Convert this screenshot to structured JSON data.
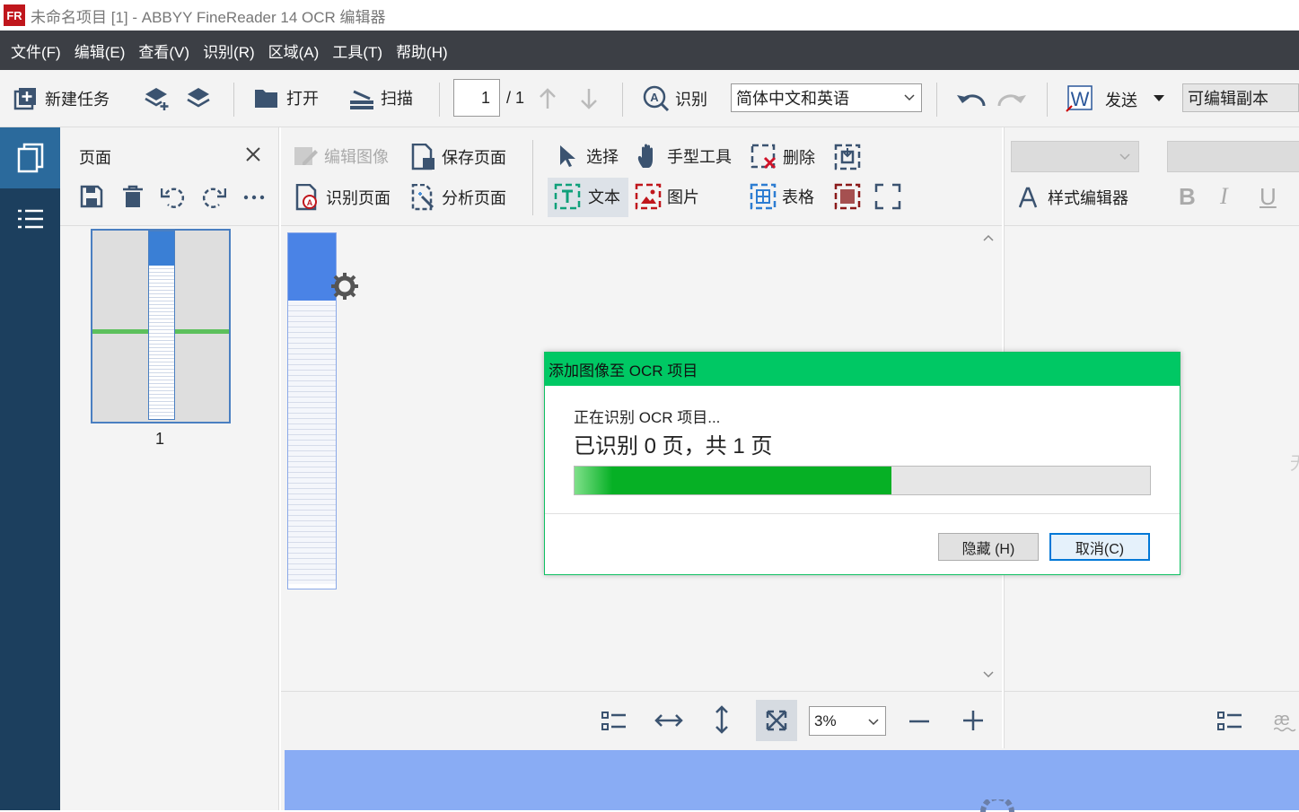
{
  "window": {
    "title": "未命名项目 [1] - ABBYY FineReader 14 OCR 编辑器",
    "app_icon_text": "FR"
  },
  "menu": [
    "文件(F)",
    "编辑(E)",
    "查看(V)",
    "识别(R)",
    "区域(A)",
    "工具(T)",
    "帮助(H)"
  ],
  "toolbar": {
    "new_task": "新建任务",
    "open": "打开",
    "scan": "扫描",
    "page_current": "1",
    "page_total": "/ 1",
    "recognize": "识别",
    "language": "简体中文和英语",
    "send": "发送",
    "output": "可编辑副本"
  },
  "pages_panel": {
    "title": "页面",
    "thumb_label": "1"
  },
  "image_toolbar": {
    "edit_image": "编辑图像",
    "save_page": "保存页面",
    "select": "选择",
    "hand_tool": "手型工具",
    "delete": "删除",
    "recognize_page": "识别页面",
    "analyze_page": "分析页面",
    "text": "文本",
    "picture": "图片",
    "table": "表格"
  },
  "text_toolbar": {
    "style_editor": "样式编辑器",
    "bold": "B",
    "italic": "I",
    "underline": "U",
    "edge_text": "无"
  },
  "zoom": {
    "value": "3%"
  },
  "dialog": {
    "title": "添加图像至 OCR 项目",
    "status": "正在识别 OCR 项目...",
    "progress_text": "已识别 0 页，共 1 页",
    "progress_fraction": 0.55,
    "hide_button": "隐藏 (H)",
    "cancel_button": "取消(C)"
  },
  "colors": {
    "accent_green": "#00c864",
    "nav_dark": "#1c3f5e",
    "nav_selected": "#2b6a9c",
    "menubar": "#3c3f45",
    "progress": "#06b025",
    "bottom_blue": "#89acf4"
  }
}
